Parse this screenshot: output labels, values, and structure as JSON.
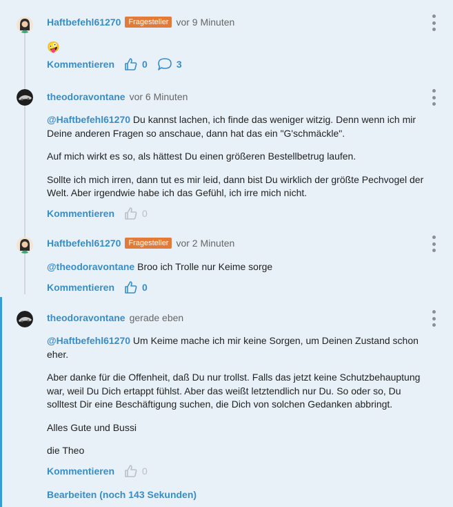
{
  "comments": [
    {
      "user": "Haftbefehl61270",
      "badge": "Fragesteller",
      "time": "vor 9 Minuten",
      "emoji": "🤪",
      "action": "Kommentieren",
      "likes": "0",
      "replies": "3"
    },
    {
      "user": "theodoravontane",
      "time": "vor 6 Minuten",
      "mention": "@Haftbefehl61270",
      "p1": "Du kannst lachen, ich finde das weniger witzig. Denn wenn ich mir Deine anderen Fragen so anschaue, dann hat das ein \"G'schmäckle\".",
      "p2": "Auf mich wirkt es so, als hättest Du einen größeren Bestellbetrug laufen.",
      "p3": "Sollte ich mich irren, dann tut es mir leid, dann bist Du wirklich der größte Pechvogel der Welt. Aber irgendwie habe ich das Gefühl, ich irre mich nicht.",
      "action": "Kommentieren",
      "likes": "0"
    },
    {
      "user": "Haftbefehl61270",
      "badge": "Fragesteller",
      "time": "vor 2 Minuten",
      "mention": "@theodoravontane",
      "p1": "Broo ich Trolle nur Keime sorge",
      "action": "Kommentieren",
      "likes": "0"
    },
    {
      "user": "theodoravontane",
      "time": "gerade eben",
      "mention": "@Haftbefehl61270",
      "p1": "Um Keime mache ich mir keine Sorgen, um Deinen Zustand schon eher.",
      "p2": "Aber danke für die Offenheit, daß Du nur trollst. Falls das jetzt keine Schutzbehauptung war, weil Du Dich ertappt fühlst. Aber das weißt letztendlich nur Du. So oder so, Du solltest Dir eine Beschäftigung suchen, die Dich von solchen Gedanken abbringt.",
      "p3": "Alles Gute und Bussi",
      "p4": "die Theo",
      "action": "Kommentieren",
      "likes": "0",
      "edit": "Bearbeiten (noch 143 Sekunden)"
    }
  ],
  "colors": {
    "accent": "#3a8cc4",
    "badge": "#e27b3a",
    "background": "#e8f1f8",
    "highlight": "#3a9bd9"
  }
}
